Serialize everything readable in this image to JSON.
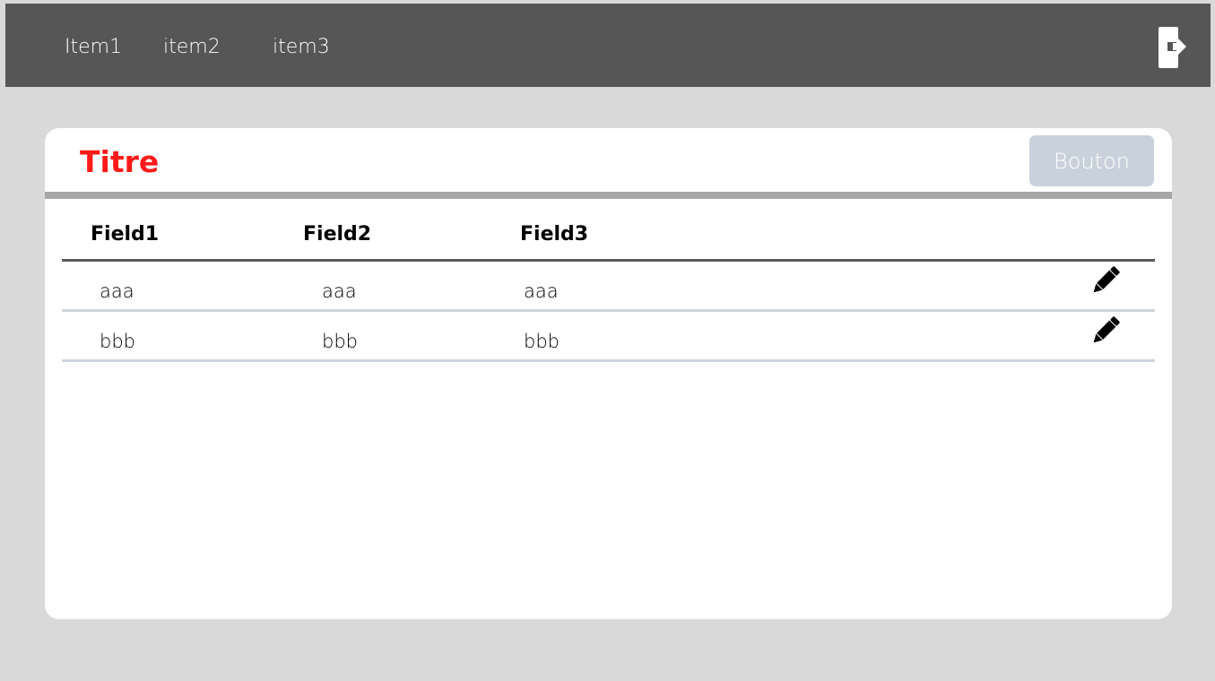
{
  "nav": {
    "items": [
      {
        "label": "Item1"
      },
      {
        "label": "item2"
      },
      {
        "label": "item3"
      }
    ],
    "logout_icon": "logout-icon"
  },
  "card": {
    "title": "Titre",
    "button_label": "Bouton",
    "colors": {
      "title": "#ff1a1a",
      "button_bg": "#c9d2dc",
      "topbar_bg": "#565656"
    }
  },
  "table": {
    "columns": [
      "Field1",
      "Field2",
      "Field3"
    ],
    "rows": [
      {
        "cells": [
          "aaa",
          "aaa",
          "aaa"
        ],
        "action_icon": "pencil-icon"
      },
      {
        "cells": [
          "bbb",
          "bbb",
          "bbb"
        ],
        "action_icon": "pencil-icon"
      }
    ]
  }
}
